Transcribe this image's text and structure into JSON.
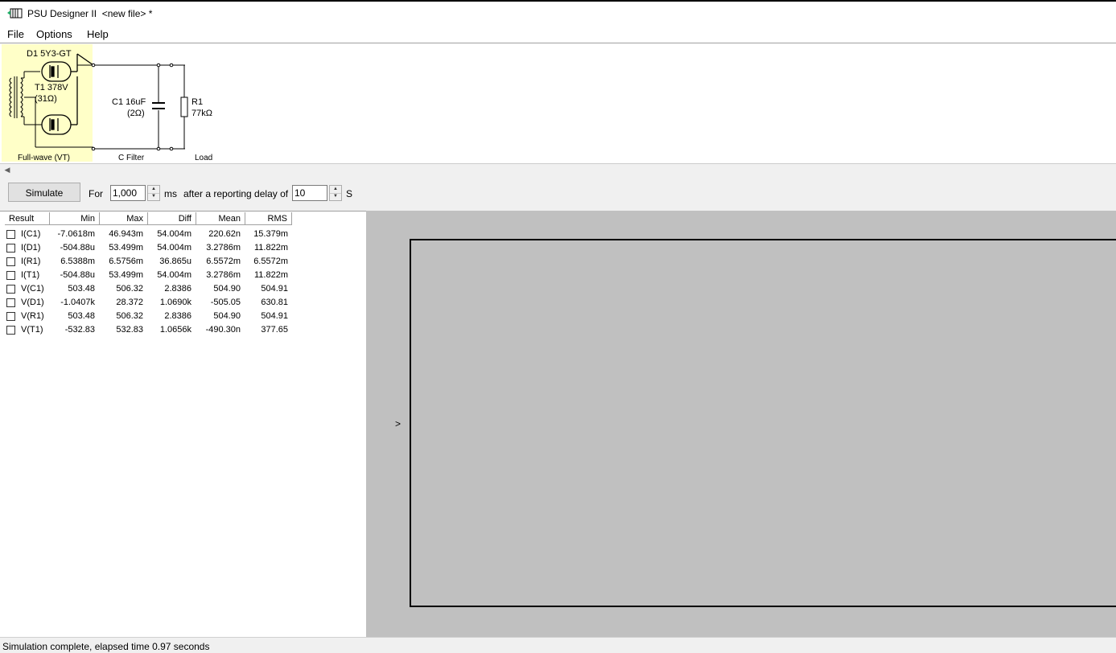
{
  "window": {
    "title": "PSU Designer II  <new file> *"
  },
  "menu": [
    "File",
    "Options",
    "Help"
  ],
  "schematic": {
    "rectifier": {
      "diode_label": "D1 5Y3-GT",
      "transformer_label": "T1 378V",
      "transformer_res": "(31Ω)",
      "section": "Full-wave (VT)"
    },
    "filter": {
      "cap_label": "C1 16uF",
      "cap_res": "(2Ω)",
      "section": "C Filter"
    },
    "load": {
      "res_name": "R1",
      "res_value": "77kΩ",
      "section": "Load"
    }
  },
  "toolbar": {
    "simulate_label": "Simulate",
    "for_label": "For",
    "duration_value": "1,000",
    "ms_label": "ms",
    "delay_label": "after a reporting delay of",
    "delay_value": "10",
    "s_label": "S"
  },
  "results": {
    "headers": [
      "Result",
      "Min",
      "Max",
      "Diff",
      "Mean",
      "RMS"
    ],
    "rows": [
      [
        "I(C1)",
        "-7.0618m",
        "46.943m",
        "54.004m",
        "220.62n",
        "15.379m"
      ],
      [
        "I(D1)",
        "-504.88u",
        "53.499m",
        "54.004m",
        "3.2786m",
        "11.822m"
      ],
      [
        "I(R1)",
        "6.5388m",
        "6.5756m",
        "36.865u",
        "6.5572m",
        "6.5572m"
      ],
      [
        "I(T1)",
        "-504.88u",
        "53.499m",
        "54.004m",
        "3.2786m",
        "11.822m"
      ],
      [
        "V(C1)",
        "503.48",
        "506.32",
        "2.8386",
        "504.90",
        "504.91"
      ],
      [
        "V(D1)",
        "-1.0407k",
        "28.372",
        "1.0690k",
        "-505.05",
        "630.81"
      ],
      [
        "V(R1)",
        "503.48",
        "506.32",
        "2.8386",
        "504.90",
        "504.91"
      ],
      [
        "V(T1)",
        "-532.83",
        "532.83",
        "1.0656k",
        "-490.30n",
        "377.65"
      ]
    ]
  },
  "graph": {
    "marker": ">"
  },
  "status": {
    "text": "Simulation complete, elapsed time 0.97 seconds"
  }
}
